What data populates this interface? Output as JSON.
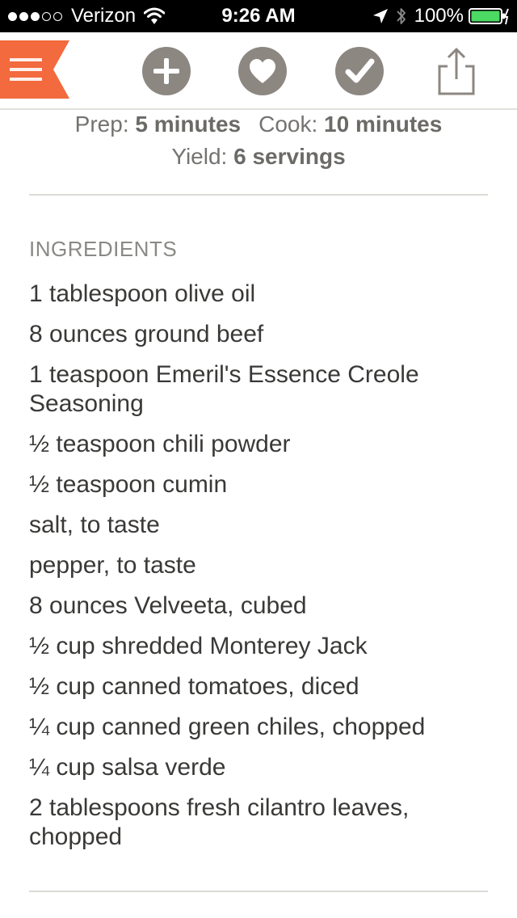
{
  "status_bar": {
    "carrier": "Verizon",
    "time": "9:26 AM",
    "battery": "100%",
    "signal_bars_filled": 3,
    "signal_bars_total": 5
  },
  "toolbar": {
    "icons": [
      "menu-icon",
      "add-icon",
      "heart-icon",
      "checkmark-icon",
      "share-icon"
    ],
    "accent_color": "#f26a3d",
    "button_color": "#8d8782"
  },
  "recipe": {
    "prep_label": "Prep:",
    "prep_value": "5 minutes",
    "cook_label": "Cook:",
    "cook_value": "10 minutes",
    "yield_label": "Yield:",
    "yield_value": "6 servings"
  },
  "ingredients": {
    "heading": "INGREDIENTS",
    "items": [
      "1 tablespoon olive oil",
      "8 ounces ground beef",
      "1 teaspoon Emeril's Essence Creole Seasoning",
      "½ teaspoon chili powder",
      "½ teaspoon cumin",
      "salt, to taste",
      "pepper, to taste",
      "8 ounces Velveeta, cubed",
      "½ cup shredded Monterey Jack",
      "½ cup canned tomatoes, diced",
      "¼ cup canned green chiles, chopped",
      "¼ cup salsa verde",
      "2 tablespoons fresh cilantro leaves, chopped"
    ]
  }
}
